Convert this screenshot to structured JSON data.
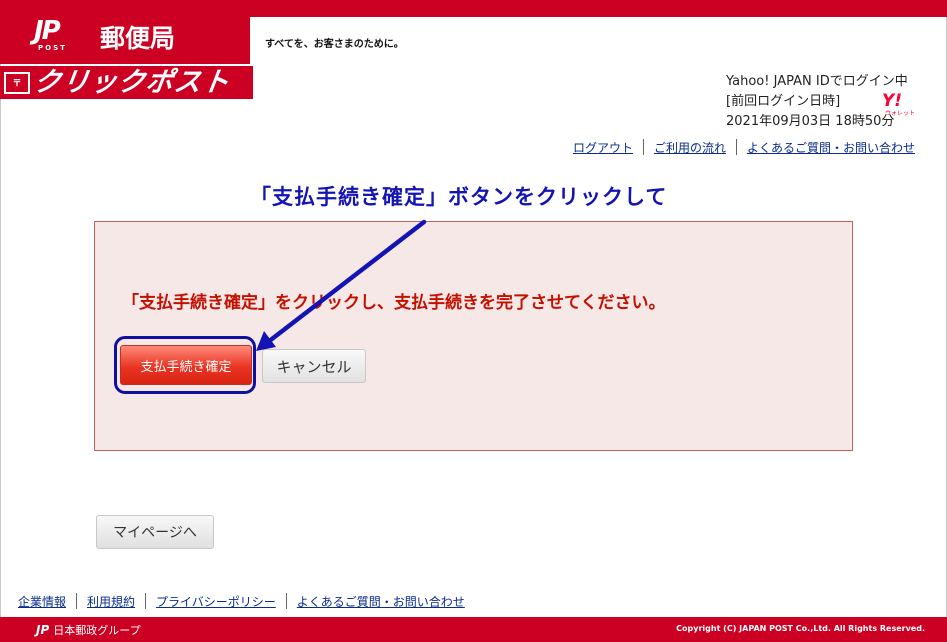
{
  "header": {
    "logo_mark": "JP",
    "logo_sub": "POST",
    "logo_title": "郵便局",
    "tagline": "すべてを、お客さまのために。",
    "service_box": "〒",
    "service_name": "クリックポスト"
  },
  "login": {
    "line1": "Yahoo! JAPAN IDでログイン中",
    "line2": "[前回ログイン日時]",
    "line3": "2021年09月03日 18時50分",
    "badge": "Y!",
    "badge_sub": "ウォレット"
  },
  "header_links": {
    "logout": "ログアウト",
    "flow": "ご利用の流れ",
    "faq": "よくあるご質問・お問い合わせ"
  },
  "annotation": "「支払手続き確定」ボタンをクリックして",
  "main": {
    "instruction": "「支払手続き確定」をクリックし、支払手続きを完了させてください。",
    "confirm_label": "支払手続き確定",
    "cancel_label": "キャンセル"
  },
  "mypage_label": "マイページへ",
  "footer": {
    "links": [
      "企業情報",
      "利用規約",
      "プライバシーポリシー",
      "よくあるご質問・お問い合わせ"
    ],
    "group": "日本郵政グループ",
    "group_mark": "JP",
    "copyright": "Copyright (C) JAPAN POST Co.,Ltd.  All Rights Reserved."
  },
  "colors": {
    "brand_red": "#cc0022",
    "annotation_blue": "#1414b4",
    "instruction_red": "#c41000"
  }
}
